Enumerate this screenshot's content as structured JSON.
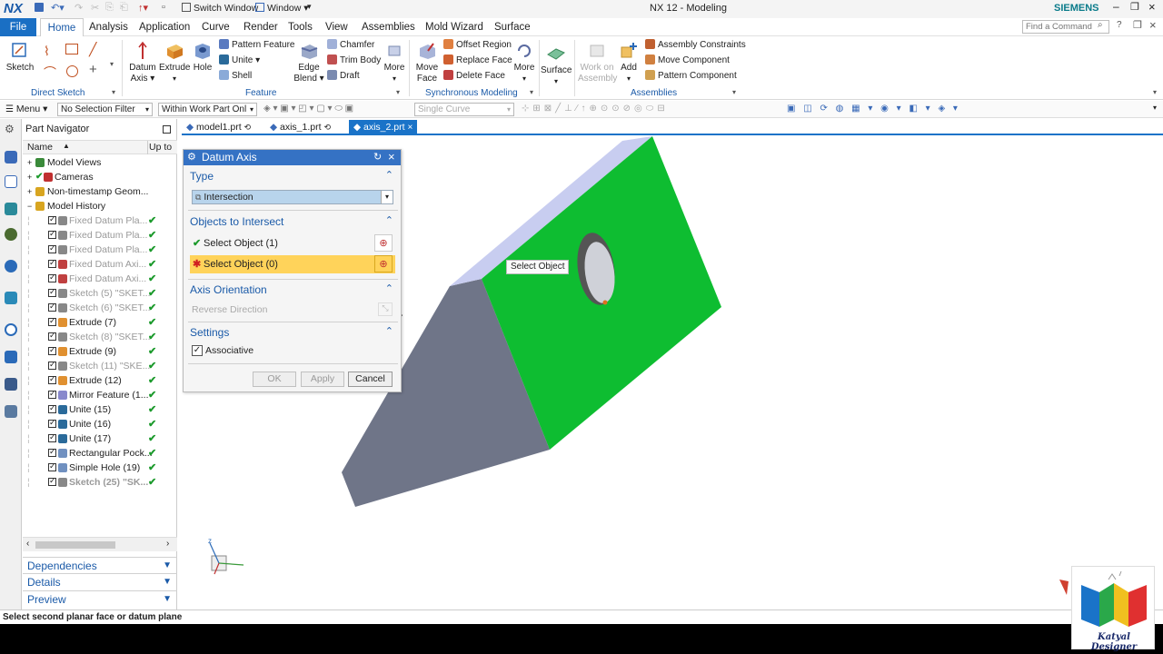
{
  "app": {
    "logo": "NX",
    "title": "NX 12 - Modeling",
    "brand": "SIEMENS",
    "switch_window": "Switch Window",
    "window_menu": "Window ▾",
    "search_placeholder": "Find a Command"
  },
  "menu": {
    "file": "File",
    "tabs": [
      "Home",
      "Analysis",
      "Application",
      "Curve",
      "Render",
      "Tools",
      "View",
      "Assemblies",
      "Mold Wizard",
      "Surface"
    ]
  },
  "ribbon": {
    "sketch": "Sketch",
    "direct_sketch": "Direct Sketch",
    "datum_axis_1": "Datum",
    "datum_axis_2": "Axis ▾",
    "extrude": "Extrude",
    "hole": "Hole",
    "pattern_feature": "Pattern Feature",
    "unite": "Unite ▾",
    "shell": "Shell",
    "edge_blend_1": "Edge",
    "edge_blend_2": "Blend ▾",
    "chamfer": "Chamfer",
    "trim_body": "Trim Body",
    "draft": "Draft",
    "more1": "More",
    "feature": "Feature",
    "move_face_1": "Move",
    "move_face_2": "Face",
    "offset_region": "Offset Region",
    "replace_face": "Replace Face",
    "delete_face": "Delete Face",
    "more2": "More",
    "sync_modeling": "Synchronous Modeling",
    "surface": "Surface",
    "work_on_1": "Work on",
    "work_on_2": "Assembly",
    "add": "Add",
    "assembly_constraints": "Assembly Constraints",
    "move_component": "Move Component",
    "pattern_component": "Pattern Component",
    "assemblies": "Assemblies"
  },
  "toolbar": {
    "menu": "Menu ▾",
    "selection_filter": "No Selection Filter",
    "scope": "Within Work Part Onl",
    "curve_rule": "Single Curve"
  },
  "navigator": {
    "title": "Part Navigator",
    "col_name": "Name",
    "col_up": "Up to",
    "nodes": [
      {
        "label": "Model Views",
        "color": "#3a8a3a"
      },
      {
        "label": "Cameras",
        "color": "#c03030"
      },
      {
        "label": "Non-timestamp Geom...",
        "color": "#d8a520"
      },
      {
        "label": "Model History",
        "color": "#d8a520"
      }
    ],
    "history": [
      {
        "label": "Fixed Datum Pla...",
        "color": "#888",
        "grey": true
      },
      {
        "label": "Fixed Datum Pla...",
        "color": "#888",
        "grey": true
      },
      {
        "label": "Fixed Datum Pla...",
        "color": "#888",
        "grey": true
      },
      {
        "label": "Fixed Datum Axi...",
        "color": "#c04040",
        "grey": true
      },
      {
        "label": "Fixed Datum Axi...",
        "color": "#c04040",
        "grey": true
      },
      {
        "label": "Sketch (5) \"SKET...",
        "color": "#888",
        "grey": true
      },
      {
        "label": "Sketch (6) \"SKET...",
        "color": "#888",
        "grey": true
      },
      {
        "label": "Extrude (7)",
        "color": "#e09030",
        "grey": false
      },
      {
        "label": "Sketch (8) \"SKET...",
        "color": "#888",
        "grey": true
      },
      {
        "label": "Extrude (9)",
        "color": "#e09030",
        "grey": false
      },
      {
        "label": "Sketch (11) \"SKE...",
        "color": "#888",
        "grey": true
      },
      {
        "label": "Extrude (12)",
        "color": "#e09030",
        "grey": false
      },
      {
        "label": "Mirror Feature (1...",
        "color": "#8888cc",
        "grey": false
      },
      {
        "label": "Unite (15)",
        "color": "#2a6a9a",
        "grey": false
      },
      {
        "label": "Unite (16)",
        "color": "#2a6a9a",
        "grey": false
      },
      {
        "label": "Unite (17)",
        "color": "#2a6a9a",
        "grey": false
      },
      {
        "label": "Rectangular Pock...",
        "color": "#7090c0",
        "grey": false
      },
      {
        "label": "Simple Hole (19)",
        "color": "#7090c0",
        "grey": false
      },
      {
        "label": "Sketch (25) \"SK...",
        "color": "#888",
        "grey": true,
        "bold": true
      }
    ],
    "dependencies": "Dependencies",
    "details": "Details",
    "preview": "Preview"
  },
  "doc_tabs": [
    "model1.prt",
    "axis_1.prt",
    "axis_2.prt"
  ],
  "dialog": {
    "title": "Datum Axis",
    "type_section": "Type",
    "type_value": "Intersection",
    "objects_section": "Objects to Intersect",
    "select1": "Select Object (1)",
    "select2": "Select Object (0)",
    "orientation_section": "Axis Orientation",
    "reverse": "Reverse Direction",
    "settings_section": "Settings",
    "associative": "Associative",
    "ok": "OK",
    "apply": "Apply",
    "cancel": "Cancel"
  },
  "viewport": {
    "tooltip": "Select Object",
    "model_colors": {
      "green_face": "#0ebd31",
      "grey_face": "#6f7588",
      "top_face": "#c8cdf0"
    }
  },
  "status": "Select second planar face or datum plane",
  "watermark": {
    "text": "Katyal Designer"
  }
}
